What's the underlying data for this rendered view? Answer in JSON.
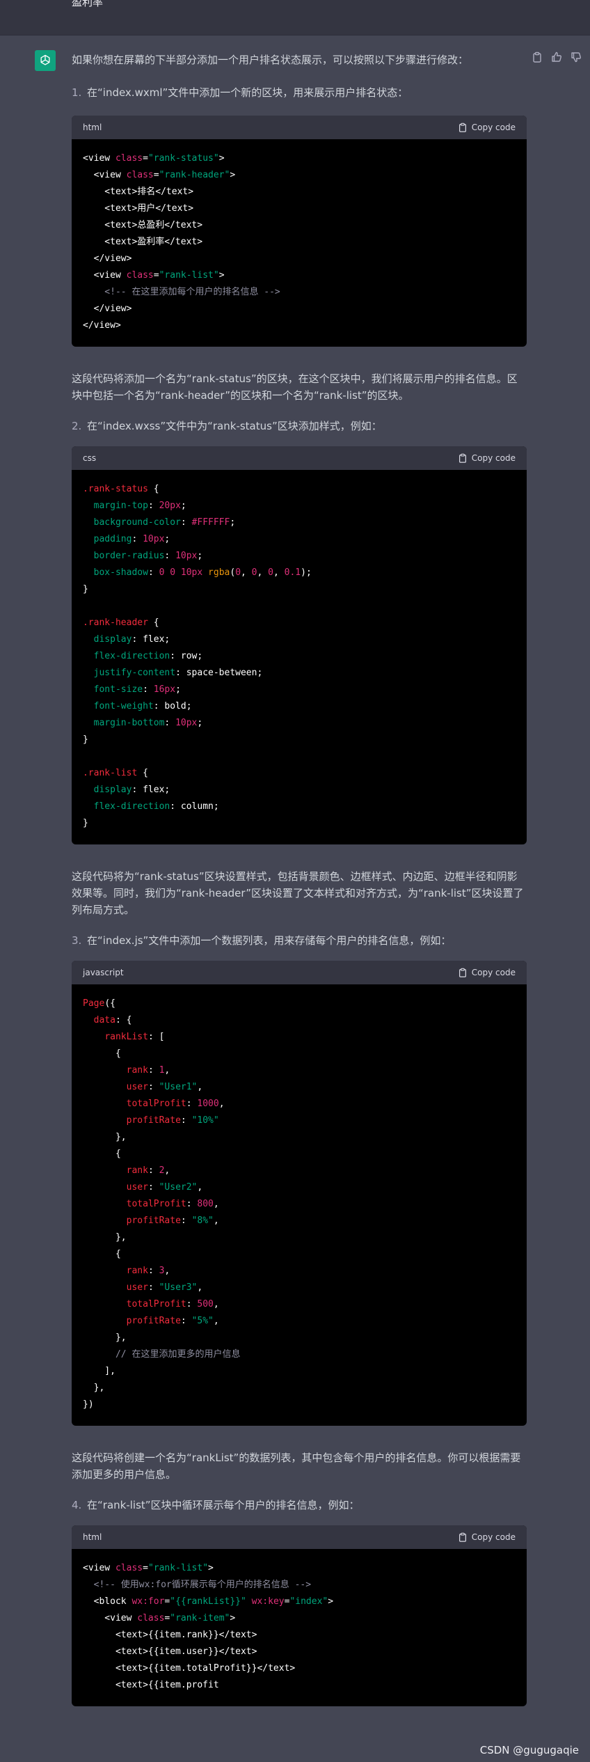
{
  "top_bar": {
    "text": "盈利率"
  },
  "assistant": {
    "avatar_icon": "openai-logo-icon"
  },
  "actions": {
    "icons": [
      "clipboard-icon",
      "thumbs-up-icon",
      "thumbs-down-icon"
    ]
  },
  "intro": "如果你想在屏幕的下半部分添加一个用户排名状态展示，可以按照以下步骤进行修改：",
  "steps": [
    {
      "num": "1.",
      "text": "在“index.wxml”文件中添加一个新的区块，用来展示用户排名状态："
    },
    {
      "num": "2.",
      "text": "在“index.wxss”文件中为“rank-status”区块添加样式，例如："
    },
    {
      "num": "3.",
      "text": "在“index.js”文件中添加一个数据列表，用来存储每个用户的排名信息，例如："
    },
    {
      "num": "4.",
      "text": "在“rank-list”区块中循环展示每个用户的排名信息，例如："
    }
  ],
  "paras": [
    "这段代码将添加一个名为“rank-status”的区块，在这个区块中，我们将展示用户的排名信息。区块中包括一个名为“rank-header”的区块和一个名为“rank-list”的区块。",
    "这段代码将为“rank-status”区块设置样式，包括背景颜色、边框样式、内边距、边框半径和阴影效果等。同时，我们为“rank-header”区块设置了文本样式和对齐方式，为“rank-list”区块设置了列布局方式。",
    "这段代码将创建一个名为“rankList”的数据列表，其中包含每个用户的排名信息。你可以根据需要添加更多的用户信息。"
  ],
  "code_blocks": [
    {
      "lang": "html",
      "copy_label": "Copy code"
    },
    {
      "lang": "css",
      "copy_label": "Copy code"
    },
    {
      "lang": "javascript",
      "copy_label": "Copy code"
    },
    {
      "lang": "html",
      "copy_label": "Copy code"
    }
  ],
  "code_lines": {
    "b1": [
      [
        [
          "t-plain",
          "<view "
        ],
        [
          "t-attr",
          "class"
        ],
        [
          "t-plain",
          "="
        ],
        [
          "t-str",
          "\"rank-status\""
        ],
        [
          "t-plain",
          ">"
        ]
      ],
      [
        [
          "t-plain",
          "  <view "
        ],
        [
          "t-attr",
          "class"
        ],
        [
          "t-plain",
          "="
        ],
        [
          "t-str",
          "\"rank-header\""
        ],
        [
          "t-plain",
          ">"
        ]
      ],
      [
        [
          "t-plain",
          "    <text>排名</text>"
        ]
      ],
      [
        [
          "t-plain",
          "    <text>用户</text>"
        ]
      ],
      [
        [
          "t-plain",
          "    <text>总盈利</text>"
        ]
      ],
      [
        [
          "t-plain",
          "    <text>盈利率</text>"
        ]
      ],
      [
        [
          "t-plain",
          "  </view>"
        ]
      ],
      [
        [
          "t-plain",
          "  <view "
        ],
        [
          "t-attr",
          "class"
        ],
        [
          "t-plain",
          "="
        ],
        [
          "t-str",
          "\"rank-list\""
        ],
        [
          "t-plain",
          ">"
        ]
      ],
      [
        [
          "t-comment",
          "    <!-- 在这里添加每个用户的排名信息 -->"
        ]
      ],
      [
        [
          "t-plain",
          "  </view>"
        ]
      ],
      [
        [
          "t-plain",
          "</view>"
        ]
      ]
    ],
    "b2": [
      [
        [
          "t-sel",
          ".rank-status"
        ],
        [
          "t-plain",
          " {"
        ]
      ],
      [
        [
          "t-plain",
          "  "
        ],
        [
          "t-prop2",
          "margin-top"
        ],
        [
          "t-plain",
          ": "
        ],
        [
          "t-num",
          "20px"
        ],
        [
          "t-plain",
          ";"
        ]
      ],
      [
        [
          "t-plain",
          "  "
        ],
        [
          "t-prop2",
          "background-color"
        ],
        [
          "t-plain",
          ": "
        ],
        [
          "t-hex",
          "#FFFFFF"
        ],
        [
          "t-plain",
          ";"
        ]
      ],
      [
        [
          "t-plain",
          "  "
        ],
        [
          "t-prop2",
          "padding"
        ],
        [
          "t-plain",
          ": "
        ],
        [
          "t-num",
          "10px"
        ],
        [
          "t-plain",
          ";"
        ]
      ],
      [
        [
          "t-plain",
          "  "
        ],
        [
          "t-prop2",
          "border-radius"
        ],
        [
          "t-plain",
          ": "
        ],
        [
          "t-num",
          "10px"
        ],
        [
          "t-plain",
          ";"
        ]
      ],
      [
        [
          "t-plain",
          "  "
        ],
        [
          "t-prop2",
          "box-shadow"
        ],
        [
          "t-plain",
          ": "
        ],
        [
          "t-num",
          "0"
        ],
        [
          "t-plain",
          " "
        ],
        [
          "t-num",
          "0"
        ],
        [
          "t-plain",
          " "
        ],
        [
          "t-num",
          "10px"
        ],
        [
          "t-plain",
          " "
        ],
        [
          "t-fn",
          "rgba"
        ],
        [
          "t-plain",
          "("
        ],
        [
          "t-num",
          "0"
        ],
        [
          "t-plain",
          ", "
        ],
        [
          "t-num",
          "0"
        ],
        [
          "t-plain",
          ", "
        ],
        [
          "t-num",
          "0"
        ],
        [
          "t-plain",
          ", "
        ],
        [
          "t-num",
          "0.1"
        ],
        [
          "t-plain",
          ");"
        ]
      ],
      [
        [
          "t-plain",
          "}"
        ]
      ],
      [
        [
          "t-plain",
          ""
        ]
      ],
      [
        [
          "t-sel",
          ".rank-header"
        ],
        [
          "t-plain",
          " {"
        ]
      ],
      [
        [
          "t-plain",
          "  "
        ],
        [
          "t-prop2",
          "display"
        ],
        [
          "t-plain",
          ": flex;"
        ]
      ],
      [
        [
          "t-plain",
          "  "
        ],
        [
          "t-prop2",
          "flex-direction"
        ],
        [
          "t-plain",
          ": row;"
        ]
      ],
      [
        [
          "t-plain",
          "  "
        ],
        [
          "t-prop2",
          "justify-content"
        ],
        [
          "t-plain",
          ": space-between;"
        ]
      ],
      [
        [
          "t-plain",
          "  "
        ],
        [
          "t-prop2",
          "font-size"
        ],
        [
          "t-plain",
          ": "
        ],
        [
          "t-num",
          "16px"
        ],
        [
          "t-plain",
          ";"
        ]
      ],
      [
        [
          "t-plain",
          "  "
        ],
        [
          "t-prop2",
          "font-weight"
        ],
        [
          "t-plain",
          ": bold;"
        ]
      ],
      [
        [
          "t-plain",
          "  "
        ],
        [
          "t-prop2",
          "margin-bottom"
        ],
        [
          "t-plain",
          ": "
        ],
        [
          "t-num",
          "10px"
        ],
        [
          "t-plain",
          ";"
        ]
      ],
      [
        [
          "t-plain",
          "}"
        ]
      ],
      [
        [
          "t-plain",
          ""
        ]
      ],
      [
        [
          "t-sel",
          ".rank-list"
        ],
        [
          "t-plain",
          " {"
        ]
      ],
      [
        [
          "t-plain",
          "  "
        ],
        [
          "t-prop2",
          "display"
        ],
        [
          "t-plain",
          ": flex;"
        ]
      ],
      [
        [
          "t-plain",
          "  "
        ],
        [
          "t-prop2",
          "flex-direction"
        ],
        [
          "t-plain",
          ": column;"
        ]
      ],
      [
        [
          "t-plain",
          "}"
        ]
      ]
    ],
    "b3": [
      [
        [
          "t-kw",
          "Page"
        ],
        [
          "t-plain",
          "({"
        ]
      ],
      [
        [
          "t-plain",
          "  "
        ],
        [
          "t-kw",
          "data"
        ],
        [
          "t-plain",
          ": {"
        ]
      ],
      [
        [
          "t-plain",
          "    "
        ],
        [
          "t-kw",
          "rankList"
        ],
        [
          "t-plain",
          ": ["
        ]
      ],
      [
        [
          "t-plain",
          "      {"
        ]
      ],
      [
        [
          "t-plain",
          "        "
        ],
        [
          "t-kw",
          "rank"
        ],
        [
          "t-plain",
          ": "
        ],
        [
          "t-num",
          "1"
        ],
        [
          "t-plain",
          ","
        ]
      ],
      [
        [
          "t-plain",
          "        "
        ],
        [
          "t-kw",
          "user"
        ],
        [
          "t-plain",
          ": "
        ],
        [
          "t-str",
          "\"User1\""
        ],
        [
          "t-plain",
          ","
        ]
      ],
      [
        [
          "t-plain",
          "        "
        ],
        [
          "t-kw",
          "totalProfit"
        ],
        [
          "t-plain",
          ": "
        ],
        [
          "t-num",
          "1000"
        ],
        [
          "t-plain",
          ","
        ]
      ],
      [
        [
          "t-plain",
          "        "
        ],
        [
          "t-kw",
          "profitRate"
        ],
        [
          "t-plain",
          ": "
        ],
        [
          "t-str",
          "\"10%\""
        ]
      ],
      [
        [
          "t-plain",
          "      },"
        ]
      ],
      [
        [
          "t-plain",
          "      {"
        ]
      ],
      [
        [
          "t-plain",
          "        "
        ],
        [
          "t-kw",
          "rank"
        ],
        [
          "t-plain",
          ": "
        ],
        [
          "t-num",
          "2"
        ],
        [
          "t-plain",
          ","
        ]
      ],
      [
        [
          "t-plain",
          "        "
        ],
        [
          "t-kw",
          "user"
        ],
        [
          "t-plain",
          ": "
        ],
        [
          "t-str",
          "\"User2\""
        ],
        [
          "t-plain",
          ","
        ]
      ],
      [
        [
          "t-plain",
          "        "
        ],
        [
          "t-kw",
          "totalProfit"
        ],
        [
          "t-plain",
          ": "
        ],
        [
          "t-num",
          "800"
        ],
        [
          "t-plain",
          ","
        ]
      ],
      [
        [
          "t-plain",
          "        "
        ],
        [
          "t-kw",
          "profitRate"
        ],
        [
          "t-plain",
          ": "
        ],
        [
          "t-str",
          "\"8%\""
        ],
        [
          "t-plain",
          ","
        ]
      ],
      [
        [
          "t-plain",
          "      },"
        ]
      ],
      [
        [
          "t-plain",
          "      {"
        ]
      ],
      [
        [
          "t-plain",
          "        "
        ],
        [
          "t-kw",
          "rank"
        ],
        [
          "t-plain",
          ": "
        ],
        [
          "t-num",
          "3"
        ],
        [
          "t-plain",
          ","
        ]
      ],
      [
        [
          "t-plain",
          "        "
        ],
        [
          "t-kw",
          "user"
        ],
        [
          "t-plain",
          ": "
        ],
        [
          "t-str",
          "\"User3\""
        ],
        [
          "t-plain",
          ","
        ]
      ],
      [
        [
          "t-plain",
          "        "
        ],
        [
          "t-kw",
          "totalProfit"
        ],
        [
          "t-plain",
          ": "
        ],
        [
          "t-num",
          "500"
        ],
        [
          "t-plain",
          ","
        ]
      ],
      [
        [
          "t-plain",
          "        "
        ],
        [
          "t-kw",
          "profitRate"
        ],
        [
          "t-plain",
          ": "
        ],
        [
          "t-str",
          "\"5%\""
        ],
        [
          "t-plain",
          ","
        ]
      ],
      [
        [
          "t-plain",
          "      },"
        ]
      ],
      [
        [
          "t-comment",
          "      // 在这里添加更多的用户信息"
        ]
      ],
      [
        [
          "t-plain",
          "    ],"
        ]
      ],
      [
        [
          "t-plain",
          "  },"
        ]
      ],
      [
        [
          "t-plain",
          "})"
        ]
      ]
    ],
    "b4": [
      [
        [
          "t-plain",
          "<view "
        ],
        [
          "t-attr",
          "class"
        ],
        [
          "t-plain",
          "="
        ],
        [
          "t-str",
          "\"rank-list\""
        ],
        [
          "t-plain",
          ">"
        ]
      ],
      [
        [
          "t-comment",
          "  <!-- 使用wx:for循环展示每个用户的排名信息 -->"
        ]
      ],
      [
        [
          "t-plain",
          "  <block "
        ],
        [
          "t-attr",
          "wx:for"
        ],
        [
          "t-plain",
          "="
        ],
        [
          "t-str",
          "\"{{rankList}}\""
        ],
        [
          "t-plain",
          " "
        ],
        [
          "t-attr",
          "wx:key"
        ],
        [
          "t-plain",
          "="
        ],
        [
          "t-str",
          "\"index\""
        ],
        [
          "t-plain",
          ">"
        ]
      ],
      [
        [
          "t-plain",
          "    <view "
        ],
        [
          "t-attr",
          "class"
        ],
        [
          "t-plain",
          "="
        ],
        [
          "t-str",
          "\"rank-item\""
        ],
        [
          "t-plain",
          ">"
        ]
      ],
      [
        [
          "t-plain",
          "      <text>{{item.rank}}</text>"
        ]
      ],
      [
        [
          "t-plain",
          "      <text>{{item.user}}</text>"
        ]
      ],
      [
        [
          "t-plain",
          "      <text>{{item.totalProfit}}</text>"
        ]
      ],
      [
        [
          "t-plain",
          "      <text>{{item.profit"
        ]
      ]
    ]
  },
  "watermark": "CSDN @gugugaqie"
}
